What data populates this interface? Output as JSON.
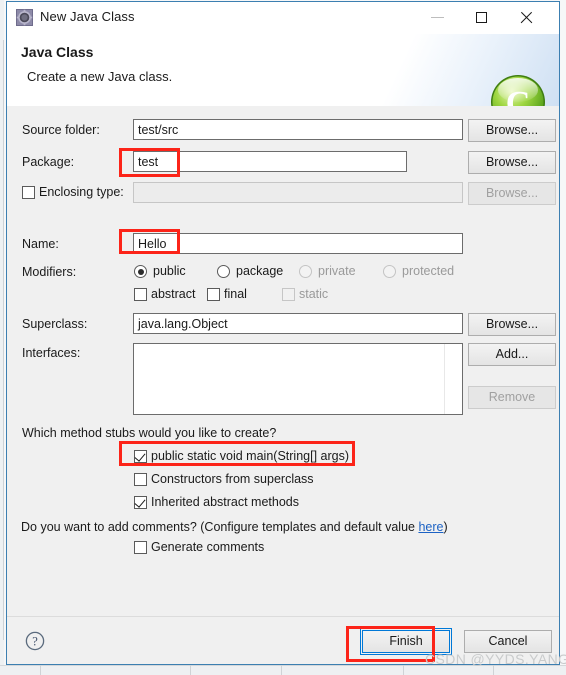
{
  "window": {
    "title": "New Java Class",
    "icon": "java-wizard-icon",
    "controls": {
      "minimize": "minimize-icon",
      "maximize": "maximize-icon",
      "close": "close-icon"
    }
  },
  "banner": {
    "title": "Java Class",
    "subtitle": "Create a new Java class.",
    "icon": "green-class-icon"
  },
  "form": {
    "source_folder": {
      "label": "Source folder:",
      "value": "test/src",
      "placeholder": "",
      "button": "Browse..."
    },
    "package": {
      "label": "Package:",
      "value": "test",
      "placeholder": "",
      "button": "Browse..."
    },
    "enclosing_type": {
      "label": "Enclosing type:",
      "checked": false,
      "value": "",
      "placeholder": "",
      "button": "Browse...",
      "disabled": true
    },
    "name": {
      "label": "Name:",
      "value": "Hello",
      "placeholder": ""
    },
    "modifiers": {
      "label": "Modifiers:",
      "radios": [
        {
          "label": "public",
          "selected": true,
          "disabled": false
        },
        {
          "label": "package",
          "selected": false,
          "disabled": false
        },
        {
          "label": "private",
          "selected": false,
          "disabled": true
        },
        {
          "label": "protected",
          "selected": false,
          "disabled": true
        }
      ],
      "checkboxes": [
        {
          "label": "abstract",
          "checked": false,
          "disabled": false
        },
        {
          "label": "final",
          "checked": false,
          "disabled": false
        },
        {
          "label": "static",
          "checked": false,
          "disabled": true
        }
      ]
    },
    "superclass": {
      "label": "Superclass:",
      "value": "java.lang.Object",
      "button": "Browse..."
    },
    "interfaces": {
      "label": "Interfaces:",
      "items": [],
      "add_button": "Add...",
      "remove_button": "Remove",
      "remove_disabled": true
    }
  },
  "stubs": {
    "question": "Which method stubs would you like to create?",
    "options": [
      {
        "label": "public static void main(String[] args)",
        "checked": true
      },
      {
        "label": "Constructors from superclass",
        "checked": false
      },
      {
        "label": "Inherited abstract methods",
        "checked": true
      }
    ]
  },
  "comments": {
    "question_prefix": "Do you want to add comments? (Configure templates and default value ",
    "link": "here",
    "question_suffix": ")",
    "option": {
      "label": "Generate comments",
      "checked": false
    }
  },
  "footer": {
    "help_icon": "help-icon",
    "finish_button": "Finish",
    "cancel_button": "Cancel"
  },
  "watermark": "CSDN @YYDS.YANG",
  "colors": {
    "annotation_red": "#fc2419",
    "focus_blue": "#0078d7",
    "link_blue": "#1c62c4",
    "dialog_bg": "#f0f0f0",
    "title_bg": "#ffffff"
  }
}
